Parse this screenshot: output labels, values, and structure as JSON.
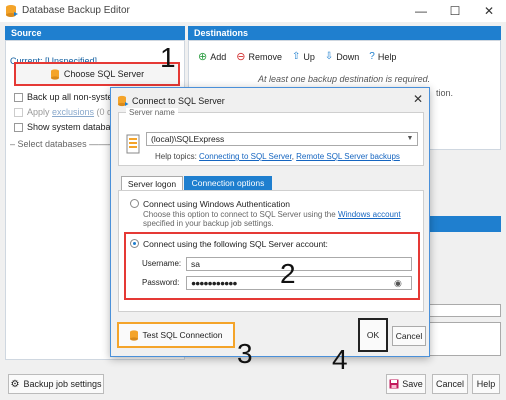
{
  "window": {
    "title": "Database Backup Editor"
  },
  "titlebar_controls": {
    "minimize": "—",
    "maximize": "☐",
    "close": "✕"
  },
  "source": {
    "header": "Source",
    "current_label": "Current: ",
    "current_value": "[Unspecified]",
    "choose_button": "Choose SQL Server",
    "checkbox_backup_all": "Back up all non-syste",
    "checkbox_apply_prefix": "Apply ",
    "checkbox_apply_link": "exclusions",
    "checkbox_apply_suffix": " (0 d",
    "checkbox_show_system": "Show system databas",
    "select_databases": "Select databases"
  },
  "destinations": {
    "header": "Destinations",
    "toolbar": {
      "add": "Add",
      "remove": "Remove",
      "up": "Up",
      "down": "Down",
      "help": "Help"
    },
    "note": "At least one backup destination is required.",
    "fragment": "tion."
  },
  "dialog": {
    "title": "Connect to SQL Server",
    "close": "✕",
    "server_name_legend": "Server name",
    "server_name_value": "(local)\\SQLExpress",
    "help_prefix": "Help topics: ",
    "help_link1": "Connecting to SQL Server",
    "help_sep": ", ",
    "help_link2": "Remote SQL Server backups",
    "tabs": {
      "active": "Server logon",
      "inactive": "Connection options"
    },
    "option_windows": "Connect using Windows Authentication",
    "option_windows_desc_prefix": "Choose this option to connect to SQL Server using the ",
    "option_windows_desc_link": "Windows account",
    "option_windows_desc_suffix": " specified in your backup job settings.",
    "option_sql": "Connect using the following SQL Server account:",
    "username_label": "Username:",
    "username_value": "sa",
    "password_label": "Password:",
    "password_value": "●●●●●●●●●●●",
    "test_button": "Test SQL Connection",
    "ok_button": "OK",
    "cancel_button": "Cancel"
  },
  "bottom": {
    "backup_job_settings": "Backup job settings",
    "save": "Save",
    "cancel": "Cancel",
    "help": "Help"
  },
  "annotations": {
    "n1": "1",
    "n2": "2",
    "n3": "3",
    "n4": "4"
  },
  "colors": {
    "accent": "#1f7fcf",
    "highlight_red": "#e53935",
    "highlight_orange": "#f4a42a",
    "highlight_black": "#222222"
  }
}
